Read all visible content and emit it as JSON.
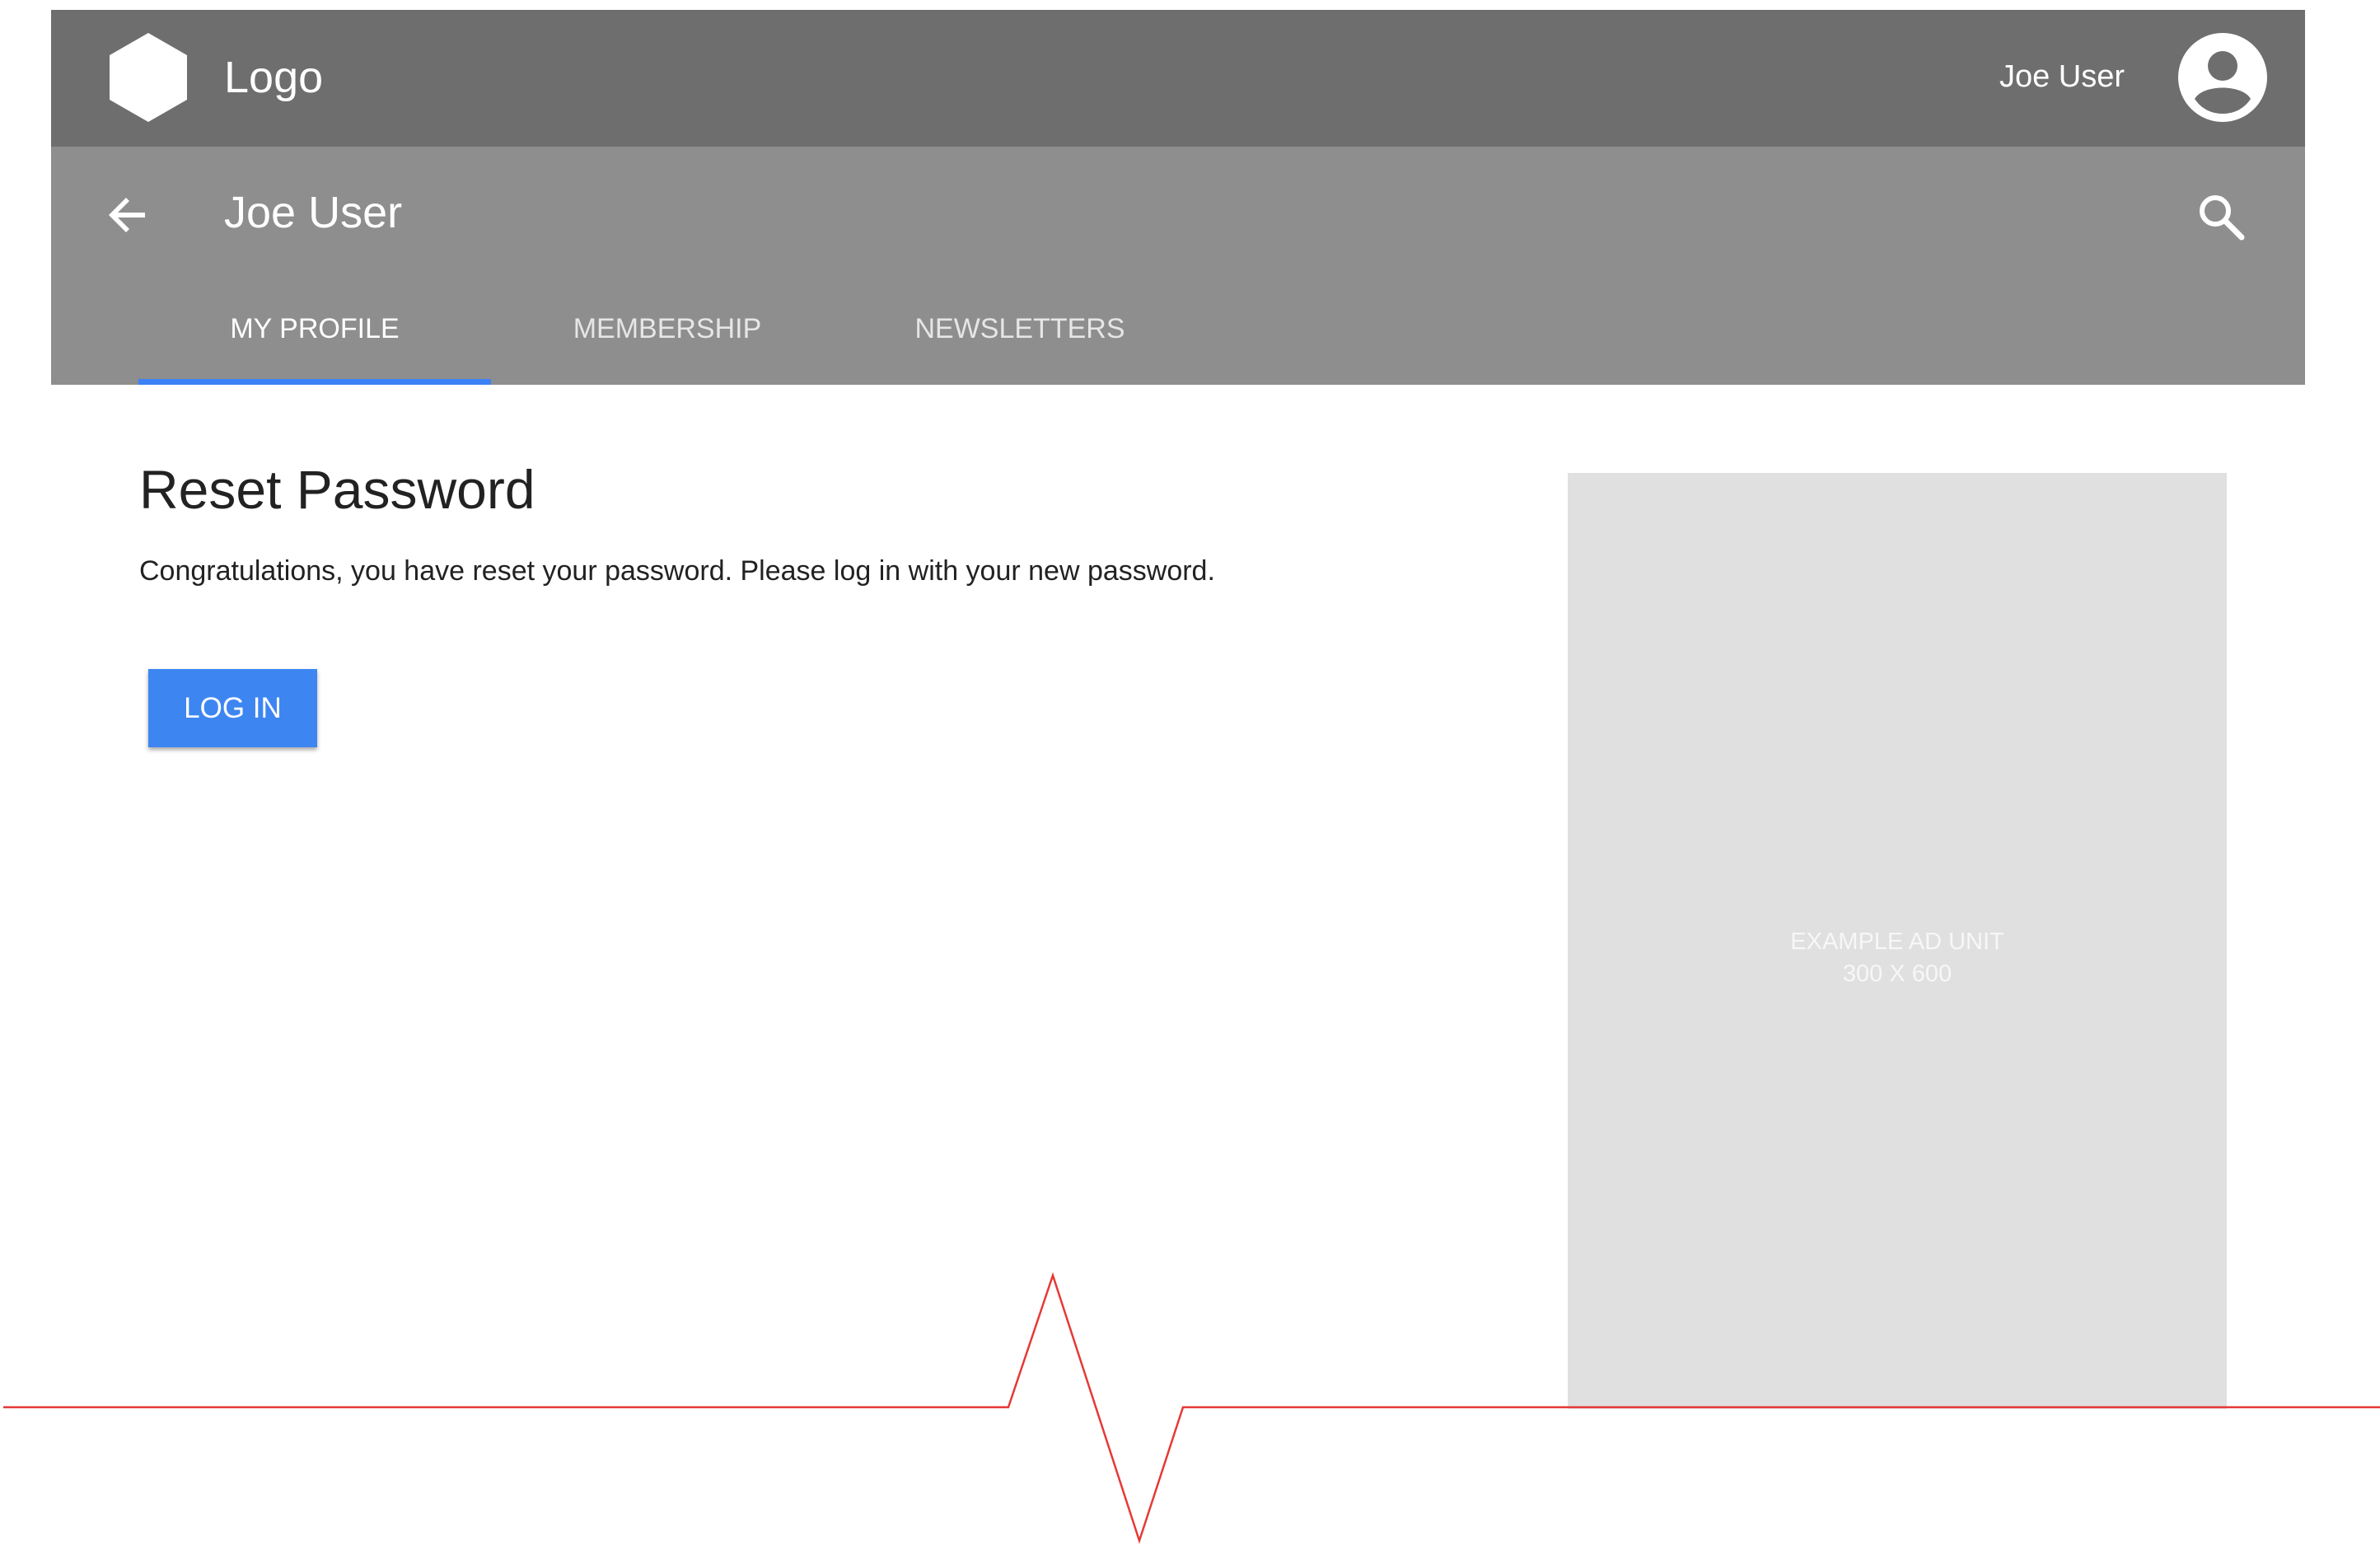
{
  "header": {
    "logo_text": "Logo",
    "user_name": "Joe User",
    "background": "#6e6e6e"
  },
  "subheader": {
    "title": "Joe User",
    "background": "#8e8e8e",
    "tabs": [
      {
        "label": "MY PROFILE",
        "active": true
      },
      {
        "label": "MEMBERSHIP",
        "active": false
      },
      {
        "label": "NEWSLETTERS",
        "active": false
      }
    ],
    "active_tab_color": "#3b82f6"
  },
  "main": {
    "title": "Reset Password",
    "message": "Congratulations, you have reset your password. Please log in with your new password.",
    "login_button_label": "LOG IN",
    "button_color": "#3d86f2"
  },
  "ad": {
    "line1": "EXAMPLE AD UNIT",
    "line2": "300 X 600"
  },
  "icons": {
    "logo": "hexagon-logo-icon",
    "avatar": "account-circle-icon",
    "back": "arrow-back-icon",
    "search": "search-icon"
  },
  "annotation": {
    "fold_line_color": "#e53935"
  }
}
